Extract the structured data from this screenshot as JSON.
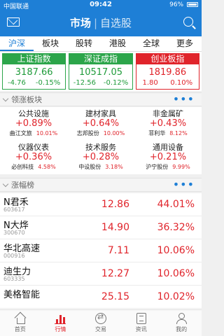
{
  "status": {
    "carrier": "中国联通",
    "time": "09:42",
    "battery": "96%"
  },
  "header": {
    "title": "市场",
    "subtitle": "自选股"
  },
  "tabs": [
    "沪深",
    "板块",
    "股转",
    "港股",
    "全球",
    "更多"
  ],
  "indices": [
    {
      "name": "上证指数",
      "value": "3187.66",
      "change": "-4.76",
      "pct": "-0.15%"
    },
    {
      "name": "深证成指",
      "value": "10517.05",
      "change": "-12.56",
      "pct": "-0.12%"
    },
    {
      "name": "创业板指",
      "value": "1819.86",
      "change": "1.80",
      "pct": "0.10%"
    }
  ],
  "sectors_header": "领涨板块",
  "sectors": [
    {
      "name": "公共设施",
      "pct": "+0.89%",
      "stock": "曲江文旅",
      "stock_pct": "10.01%"
    },
    {
      "name": "建材家具",
      "pct": "+0.64%",
      "stock": "志邦股份",
      "stock_pct": "10.00%"
    },
    {
      "name": "非金属矿",
      "pct": "+0.43%",
      "stock": "菲利华",
      "stock_pct": "8.12%"
    },
    {
      "name": "仪器仪表",
      "pct": "+0.36%",
      "stock": "必创科技",
      "stock_pct": "4.58%"
    },
    {
      "name": "技术服务",
      "pct": "+0.28%",
      "stock": "中设股份",
      "stock_pct": "3.18%"
    },
    {
      "name": "通用设备",
      "pct": "+0.21%",
      "stock": "沪宁股份",
      "stock_pct": "9.99%"
    }
  ],
  "rise_header": "涨幅榜",
  "rise_list": [
    {
      "name": "N君禾",
      "code": "603617",
      "price": "12.86",
      "pct": "44.01%"
    },
    {
      "name": "N大烨",
      "code": "300670",
      "price": "14.90",
      "pct": "36.32%"
    },
    {
      "name": "华北高速",
      "code": "000916",
      "price": "7.11",
      "pct": "10.06%"
    },
    {
      "name": "迪生力",
      "code": "603335",
      "price": "12.27",
      "pct": "10.06%"
    },
    {
      "name": "美格智能",
      "code": "",
      "price": "25.15",
      "pct": "10.02%"
    }
  ],
  "bottom_nav": [
    "首页",
    "行情",
    "交易",
    "资讯",
    "我的"
  ],
  "colors": {
    "brand": "#1e7fd6",
    "up": "#e0242b",
    "down": "#2ca54a"
  }
}
